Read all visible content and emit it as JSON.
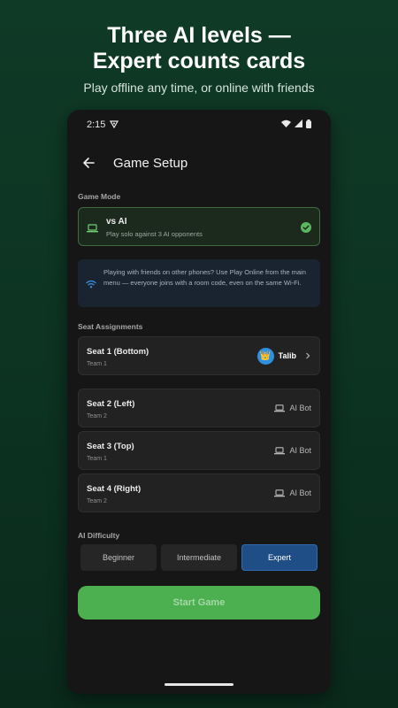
{
  "promo": {
    "title_line1": "Three AI levels —",
    "title_line2": "Expert counts cards",
    "subtitle": "Play offline any time, or online with friends"
  },
  "status_bar": {
    "time": "2:15"
  },
  "app_bar": {
    "title": "Game Setup",
    "back_icon": "arrow-left-icon"
  },
  "game_mode": {
    "label": "Game Mode",
    "selected": {
      "title": "vs AI",
      "description": "Play solo against 3 AI opponents",
      "icon": "laptop-icon"
    },
    "info": "Playing with friends on other phones? Use Play Online from the main menu — everyone joins with a room code, even on the same Wi-Fi."
  },
  "seats": {
    "label": "Seat Assignments",
    "items": [
      {
        "name": "Seat 1 (Bottom)",
        "team": "Team 1",
        "player": "Talib",
        "player_type": "human"
      },
      {
        "name": "Seat 2 (Left)",
        "team": "Team 2",
        "player": "AI Bot",
        "player_type": "ai"
      },
      {
        "name": "Seat 3 (Top)",
        "team": "Team 1",
        "player": "AI Bot",
        "player_type": "ai"
      },
      {
        "name": "Seat 4 (Right)",
        "team": "Team 2",
        "player": "AI Bot",
        "player_type": "ai"
      }
    ]
  },
  "difficulty": {
    "label": "AI Difficulty",
    "options": [
      "Beginner",
      "Intermediate",
      "Expert"
    ],
    "selected": "Expert"
  },
  "start_button": {
    "label": "Start Game"
  },
  "colors": {
    "accent_green": "#4caf50",
    "selected_blue": "#1e4e85",
    "background_dark": "#161616",
    "promo_green": "#0f3a26"
  }
}
